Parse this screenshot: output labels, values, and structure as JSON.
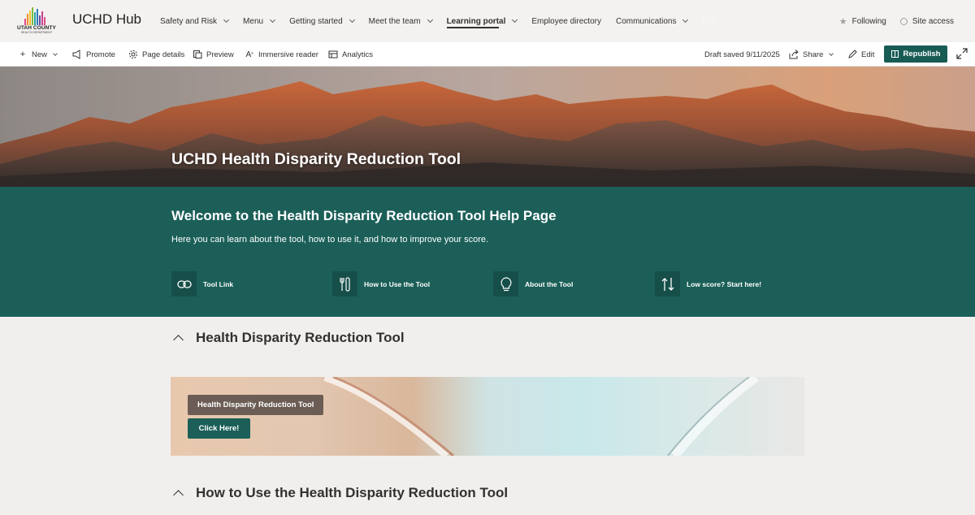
{
  "site": {
    "logo_text": "UTAH COUNTY",
    "logo_subtext": "HEALTH DEPARTMENT",
    "name": "UCHD Hub"
  },
  "nav": {
    "links": [
      {
        "label": "Safety and Risk",
        "dropdown": true
      },
      {
        "label": "Menu",
        "dropdown": true
      },
      {
        "label": "Getting started",
        "dropdown": true
      },
      {
        "label": "Meet the team",
        "dropdown": true
      },
      {
        "label": "Learning portal",
        "dropdown": true,
        "active": true
      },
      {
        "label": "Employee directory",
        "dropdown": false
      },
      {
        "label": "Communications",
        "dropdown": true
      },
      {
        "label": "Edit",
        "dropdown": false
      }
    ],
    "following": "Following",
    "site_access": "Site access"
  },
  "commandbar": {
    "new": "New",
    "promote": "Promote",
    "page_details": "Page details",
    "preview": "Preview",
    "immersive_reader": "Immersive reader",
    "analytics": "Analytics",
    "draft_status": "Draft saved 9/11/2025",
    "share": "Share",
    "edit": "Edit",
    "republish": "Republish"
  },
  "hero": {
    "title": "UCHD Health Disparity Reduction Tool"
  },
  "welcome": {
    "heading": "Welcome to the Health Disparity Reduction Tool Help Page",
    "subtext": "Here you can learn about the tool, how to use it, and how to improve your score.",
    "quick_links": [
      {
        "label": "Tool Link",
        "icon": "link-icon"
      },
      {
        "label": "How to Use the Tool",
        "icon": "tools-icon"
      },
      {
        "label": "About the Tool",
        "icon": "lightbulb-icon"
      },
      {
        "label": "Low score? Start here!",
        "icon": "sort-arrows-icon"
      }
    ]
  },
  "sections": [
    {
      "title": "Health Disparity Reduction Tool",
      "expanded": true
    },
    {
      "title": "How to Use the Health Disparity Reduction Tool",
      "expanded": true
    }
  ],
  "banner": {
    "tag": "Health Disparity Reduction Tool",
    "button": "Click Here!"
  },
  "colors": {
    "brand_green": "#1b5f58",
    "republish": "#185b55",
    "chip": "#6b5d55"
  }
}
